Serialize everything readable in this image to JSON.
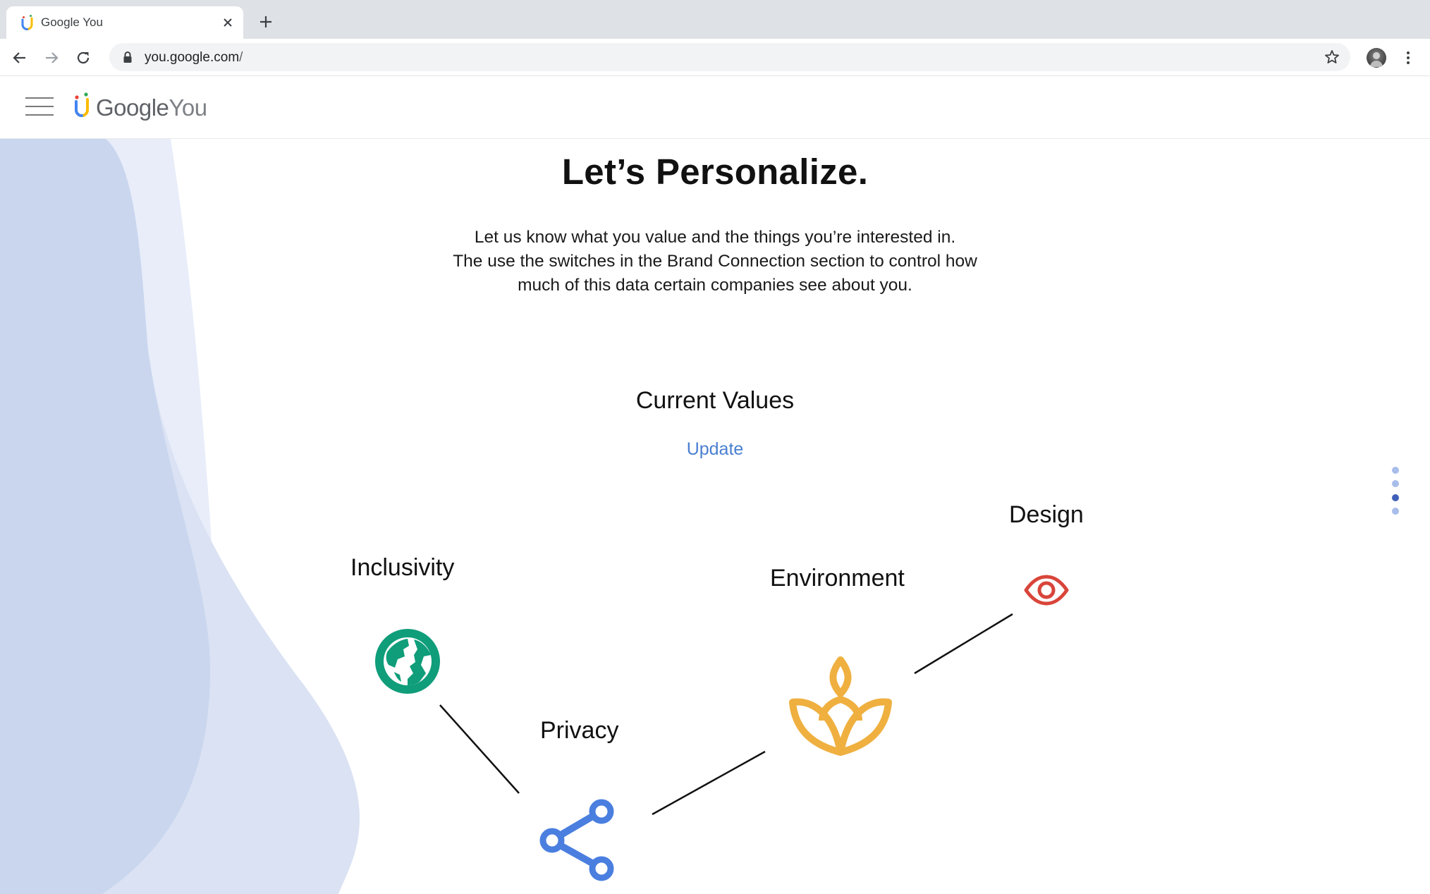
{
  "browser": {
    "tab_title": "Google You",
    "url_host": "you.google.com",
    "url_path": "/"
  },
  "header": {
    "brand_google": "Google",
    "brand_you": "You"
  },
  "main": {
    "title": "Let’s Personalize.",
    "intro_lines": [
      "Let us know what you value and the things you’re interested in.",
      "The use the switches in the Brand Connection section to control how",
      "much of this data certain companies see about you."
    ],
    "section_title": "Current Values",
    "update_label": "Update",
    "values": [
      {
        "label": "Inclusivity",
        "icon": "globe-icon",
        "color": "#0f9d7a"
      },
      {
        "label": "Privacy",
        "icon": "share-icon",
        "color": "#4a7fe0"
      },
      {
        "label": "Environment",
        "icon": "leaf-icon",
        "color": "#efb040"
      },
      {
        "label": "Design",
        "icon": "eye-icon",
        "color": "#d9453a"
      }
    ]
  },
  "pager": {
    "total": 4,
    "active_index": 2
  },
  "colors": {
    "accent_blue": "#4a7fd0",
    "bg_blob_dark": "#c9d6ee",
    "bg_blob_light": "#e8edf9"
  }
}
